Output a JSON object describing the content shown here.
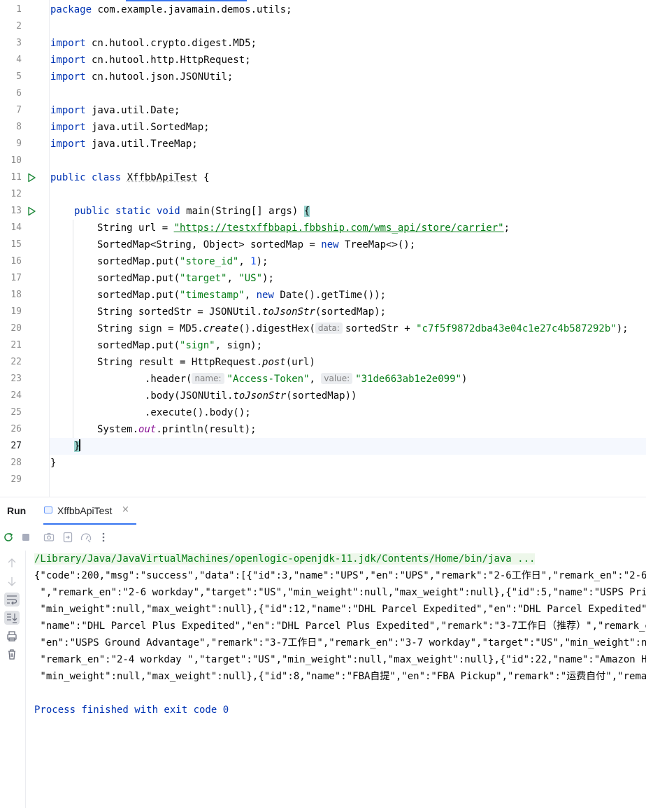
{
  "editor": {
    "line_numbers": [
      "1",
      "2",
      "3",
      "4",
      "5",
      "6",
      "7",
      "8",
      "9",
      "10",
      "11",
      "12",
      "13",
      "14",
      "15",
      "16",
      "17",
      "18",
      "19",
      "20",
      "21",
      "22",
      "23",
      "24",
      "25",
      "26",
      "27",
      "28",
      "29"
    ],
    "code": {
      "l1": {
        "kw": "package",
        "rest": " com.example.javamain.demos.utils;"
      },
      "l3": {
        "kw": "import",
        "rest": " cn.hutool.crypto.digest.MD5;"
      },
      "l4": {
        "kw": "import",
        "rest": " cn.hutool.http.HttpRequest;"
      },
      "l5": {
        "kw": "import",
        "rest": " cn.hutool.json.JSONUtil;"
      },
      "l7": {
        "kw": "import",
        "rest": " java.util.Date;"
      },
      "l8": {
        "kw": "import",
        "rest": " java.util.SortedMap;"
      },
      "l9": {
        "kw": "import",
        "rest": " java.util.TreeMap;"
      },
      "l11": {
        "kw": "public class",
        "name": "XffbbApiTest",
        "rest": " {"
      },
      "l13": {
        "kw": "public static void",
        "rest": " main(String[] args) ",
        "brace": "{"
      },
      "l14": {
        "pre": "String url = ",
        "url": "\"https://testxffbbapi.fbbship.com/wms_api/store/carrier\"",
        "post": ";"
      },
      "l15": {
        "pre": "SortedMap<String, Object> sortedMap = ",
        "kw": "new",
        "post": " TreeMap<>();"
      },
      "l16": {
        "pre": "sortedMap.put(",
        "str": "\"store_id\"",
        "mid": ", ",
        "num": "1",
        "post": ");"
      },
      "l17": {
        "pre": "sortedMap.put(",
        "str": "\"target\"",
        "mid": ", ",
        "str2": "\"US\"",
        "post": ");"
      },
      "l18": {
        "pre": "sortedMap.put(",
        "str": "\"timestamp\"",
        "mid": ", ",
        "kw": "new",
        "post": " Date().getTime());"
      },
      "l19": {
        "pre": "String sortedStr = JSONUtil.",
        "it": "toJsonStr",
        "post": "(sortedMap);"
      },
      "l20": {
        "pre": "String sign = MD5.",
        "it": "create",
        "mid": "().digestHex(",
        "hint": "data:",
        "mid2": "sortedStr + ",
        "str": "\"c7f5f9872dba43e04c1e27c4b587292b\"",
        "post": ");"
      },
      "l21": {
        "pre": "sortedMap.put(",
        "str": "\"sign\"",
        "post": ", sign);"
      },
      "l22": {
        "pre": "String result = HttpRequest.",
        "it": "post",
        "post": "(url)"
      },
      "l23": {
        "pre": ".header(",
        "hint": "name:",
        "str": "\"Access-Token\"",
        "mid": ", ",
        "hint2": "value:",
        "str2": "\"31de663ab1e2e099\"",
        "post": ")"
      },
      "l24": {
        "pre": ".body(JSONUtil.",
        "it": "toJsonStr",
        "post": "(sortedMap))"
      },
      "l25": {
        "pre": ".execute().body();"
      },
      "l26": {
        "pre": "System.",
        "field": "out",
        "post": ".println(result);"
      },
      "l27": {
        "brace": "}"
      },
      "l28": {
        "pre": "}"
      }
    }
  },
  "panel": {
    "title": "Run",
    "tab_label": "XffbbApiTest",
    "tab_close": "×",
    "console": [
      "/Library/Java/JavaVirtualMachines/openlogic-openjdk-11.jdk/Contents/Home/bin/java ...",
      "{\"code\":200,\"msg\":\"success\",\"data\":[{\"id\":3,\"name\":\"UPS\",\"en\":\"UPS\",\"remark\":\"2-6工作日\",\"remark_en\":\"2-6",
      " \",\"remark_en\":\"2-6 workday\",\"target\":\"US\",\"min_weight\":null,\"max_weight\":null},{\"id\":5,\"name\":\"USPS Pri",
      " \"min_weight\":null,\"max_weight\":null},{\"id\":12,\"name\":\"DHL Parcel Expedited\",\"en\":\"DHL Parcel Expedited\"",
      " \"name\":\"DHL Parcel Plus Expedited\",\"en\":\"DHL Parcel Plus Expedited\",\"remark\":\"3-7工作日（推荐）\",\"remark_e",
      " \"en\":\"USPS Ground Advantage\",\"remark\":\"3-7工作日\",\"remark_en\":\"3-7 workday\",\"target\":\"US\",\"min_weight\":nu",
      " \"remark_en\":\"2-4 workday \",\"target\":\"US\",\"min_weight\":null,\"max_weight\":null},{\"id\":22,\"name\":\"Amazon Ho",
      " \"min_weight\":null,\"max_weight\":null},{\"id\":8,\"name\":\"FBA自提\",\"en\":\"FBA Pickup\",\"remark\":\"运费自付\",\"remar",
      "",
      "Process finished with exit code 0"
    ]
  },
  "colors": {
    "keyword": "#0033b3",
    "string": "#067d17",
    "number": "#1750eb",
    "field": "#871094",
    "accent": "#3574f0"
  }
}
